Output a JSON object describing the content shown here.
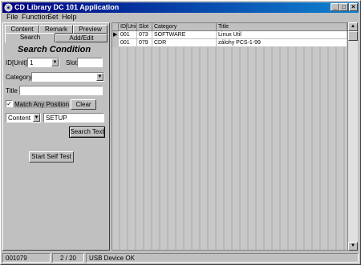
{
  "window": {
    "title": "CD Library DC 101 Application"
  },
  "menu": [
    "File",
    "Function",
    "Set",
    "Help"
  ],
  "tabs": {
    "row1": [
      "Content",
      "Remark",
      "Preview"
    ],
    "row2": [
      "Search",
      "Add/Edit"
    ]
  },
  "search": {
    "heading": "Search Condition",
    "id_label": "ID[Unit]",
    "id_value": "1",
    "slot_label": "Slot",
    "category_label": "Category",
    "title_label": "Title",
    "match_label": "Match Any Position",
    "clear_label": "Clear",
    "field_select": "Content",
    "search_value": "SETUP",
    "search_button": "Search Text",
    "selftest_button": "Start Self Test"
  },
  "grid": {
    "columns": [
      "ID[Unit]",
      "Slot",
      "Category",
      "Title"
    ],
    "rows": [
      [
        "001",
        "073",
        "SOFTWARE",
        "Linux Util"
      ],
      [
        "001",
        "079",
        "CDR",
        "zálohy PCS-1-99"
      ]
    ]
  },
  "status": {
    "id": "001079",
    "page": "2 / 20",
    "device": "USB Device OK"
  }
}
